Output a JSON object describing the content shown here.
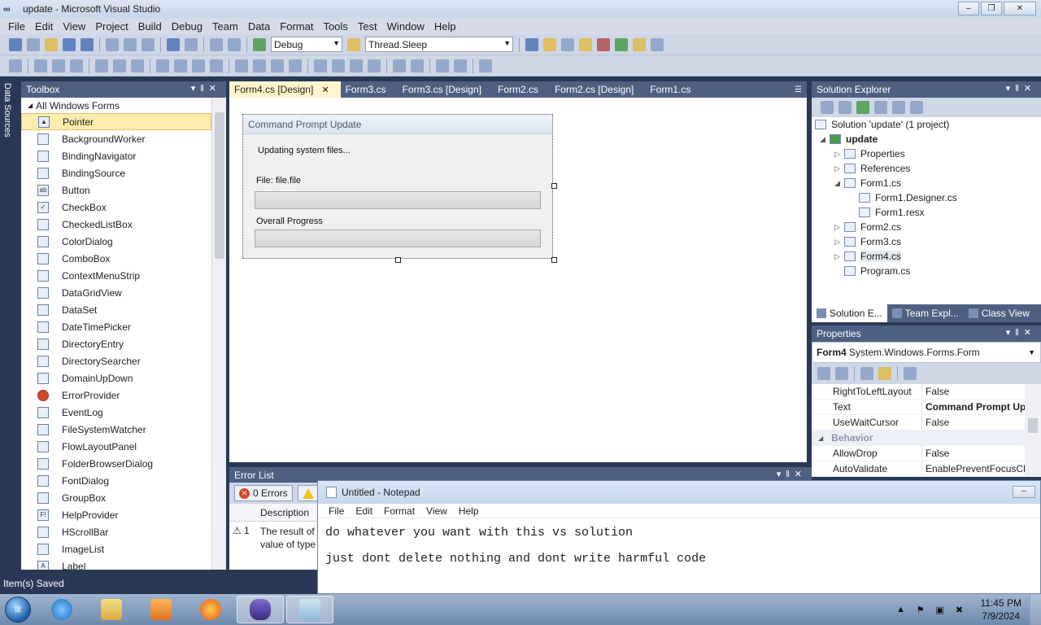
{
  "window": {
    "title": "update - Microsoft Visual Studio",
    "app_icon": "visual-studio-icon"
  },
  "menubar": [
    "File",
    "Edit",
    "View",
    "Project",
    "Build",
    "Debug",
    "Team",
    "Data",
    "Format",
    "Tools",
    "Test",
    "Window",
    "Help"
  ],
  "toolbar": {
    "configuration": "Debug",
    "find_text": "Thread.Sleep"
  },
  "left_strip": {
    "label": "Data Sources"
  },
  "toolbox": {
    "title": "Toolbox",
    "group": "All Windows Forms",
    "items": [
      "Pointer",
      "BackgroundWorker",
      "BindingNavigator",
      "BindingSource",
      "Button",
      "CheckBox",
      "CheckedListBox",
      "ColorDialog",
      "ComboBox",
      "ContextMenuStrip",
      "DataGridView",
      "DataSet",
      "DateTimePicker",
      "DirectoryEntry",
      "DirectorySearcher",
      "DomainUpDown",
      "ErrorProvider",
      "EventLog",
      "FileSystemWatcher",
      "FlowLayoutPanel",
      "FolderBrowserDialog",
      "FontDialog",
      "GroupBox",
      "HelpProvider",
      "HScrollBar",
      "ImageList",
      "Label"
    ],
    "icon_labels": {
      "button": "ab",
      "helpprovider": "F!"
    }
  },
  "doc_tabs": [
    "Form4.cs [Design]",
    "Form3.cs",
    "Form3.cs [Design]",
    "Form2.cs",
    "Form2.cs [Design]",
    "Form1.cs"
  ],
  "form4": {
    "title": "Command Prompt Update",
    "status": "Updating system files...",
    "file_label": "File: file.file",
    "overall_label": "Overall Progress"
  },
  "solution_explorer": {
    "title": "Solution Explorer",
    "nodes": [
      {
        "label": "Solution 'update' (1 project)"
      },
      {
        "label": "update"
      },
      {
        "label": "Properties"
      },
      {
        "label": "References"
      },
      {
        "label": "Form1.cs"
      },
      {
        "label": "Form1.Designer.cs"
      },
      {
        "label": "Form1.resx"
      },
      {
        "label": "Form2.cs"
      },
      {
        "label": "Form3.cs"
      },
      {
        "label": "Form4.cs"
      },
      {
        "label": "Program.cs"
      }
    ],
    "tabs": [
      "Solution E...",
      "Team Expl...",
      "Class View"
    ]
  },
  "properties": {
    "title": "Properties",
    "object_name": "Form4",
    "object_type": "System.Windows.Forms.Form",
    "rows": [
      {
        "name": "RightToLeftLayout",
        "value": "False"
      },
      {
        "name": "Text",
        "value": "Command Prompt Up"
      },
      {
        "name": "UseWaitCursor",
        "value": "False"
      },
      {
        "name": "Behavior",
        "value": ""
      },
      {
        "name": "AllowDrop",
        "value": "False"
      },
      {
        "name": "AutoValidate",
        "value": "EnablePreventFocusCh"
      }
    ]
  },
  "error_list": {
    "title": "Error List",
    "errors_label": "0 Errors",
    "warnings_label": "1",
    "col_description": "Description",
    "row_index": "1",
    "row_line1": "The result of",
    "row_line2": "value of type"
  },
  "status_bar": "Item(s) Saved",
  "notepad": {
    "title": "Untitled - Notepad",
    "menu": [
      "File",
      "Edit",
      "Format",
      "View",
      "Help"
    ],
    "line1": "do whatever you want with this vs solution",
    "line2": "just dont delete nothing and dont write harmful code"
  },
  "taskbar": {
    "time": "11:45 PM",
    "date": "7/9/2024"
  }
}
